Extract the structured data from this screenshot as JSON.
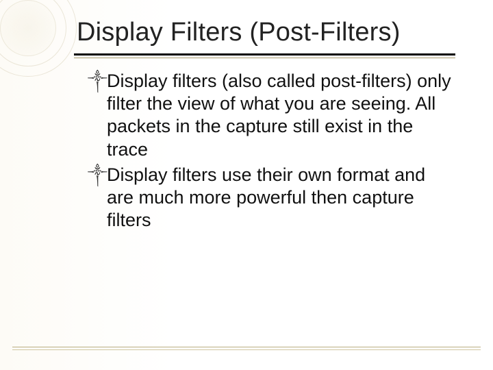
{
  "title": "Display Filters (Post-Filters)",
  "bullets": [
    "Display filters (also called post-filters) only filter the view of what you are seeing.  All packets in the capture still exist in the trace",
    "Display filters use their own format and are much more powerful then capture filters"
  ],
  "bullet_glyph": "༒"
}
